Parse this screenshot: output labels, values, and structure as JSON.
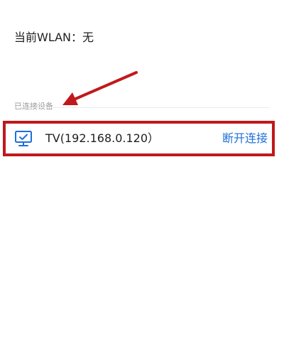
{
  "status": {
    "current_wlan": "当前WLAN：无"
  },
  "connected_section": {
    "header": "已连接设备",
    "devices": [
      {
        "name": "TV(192.168.0.120）",
        "icon": "tv-monitor-icon",
        "action_label": "断开连接"
      }
    ]
  },
  "colors": {
    "accent": "#1e6fd9",
    "annotation": "#c0191b",
    "header_text": "#9a9a9a"
  }
}
